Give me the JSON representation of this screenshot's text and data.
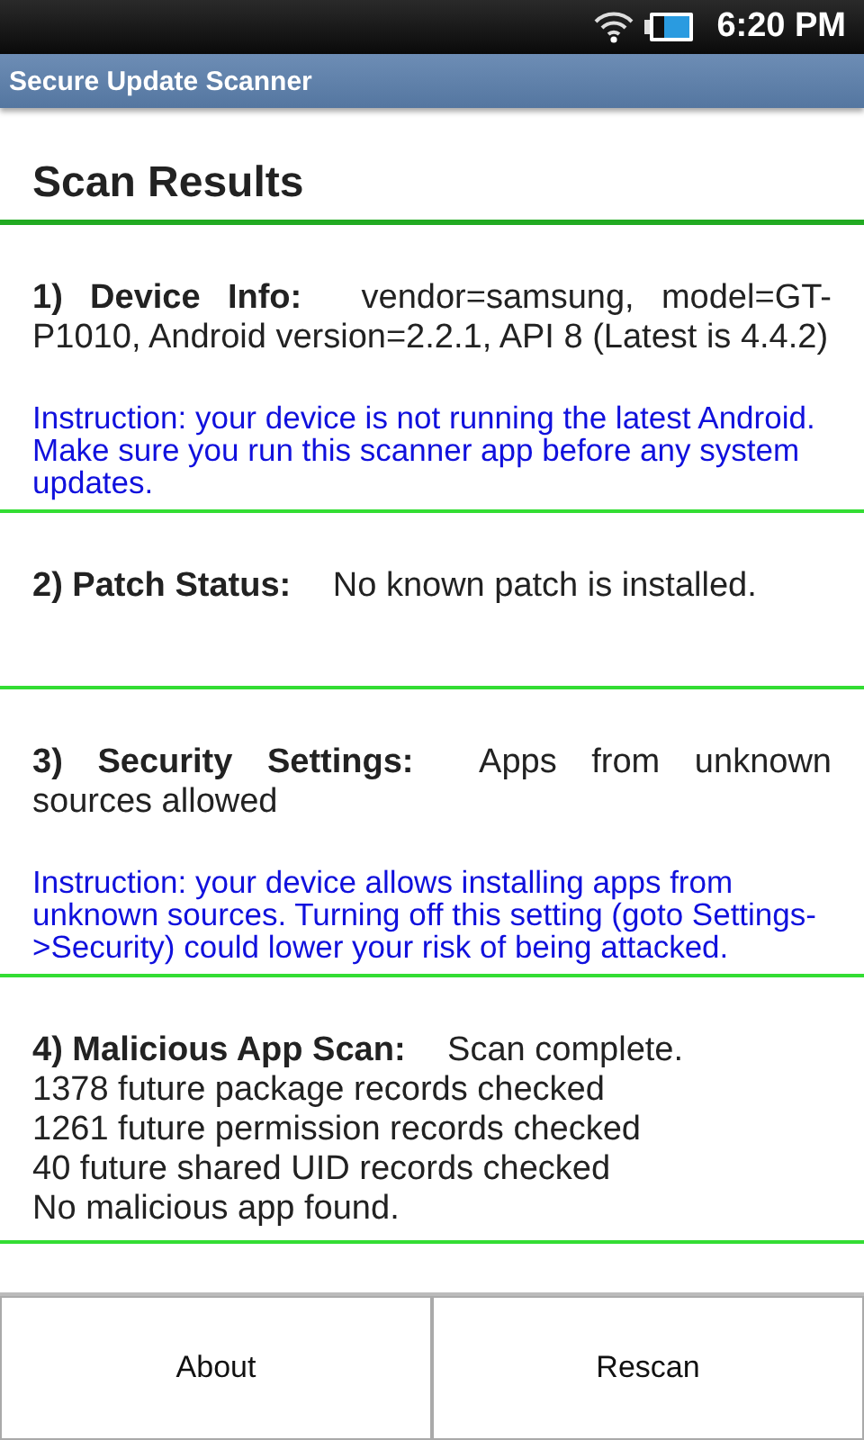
{
  "status_bar": {
    "time": "6:20 PM"
  },
  "window": {
    "title": "Secure Update Scanner"
  },
  "heading": "Scan Results",
  "sections": [
    {
      "label": "1) Device Info:",
      "text": "vendor=samsung, model=GT-P1010, Android version=2.2.1, API 8 (Latest is 4.4.2)",
      "instruction": "Instruction: your device is not running the latest Android. Make sure you run this scanner app before any system updates."
    },
    {
      "label": "2) Patch Status:",
      "text": "No known patch is installed."
    },
    {
      "label": "3) Security Settings:",
      "text": "Apps from unknown sources allowed",
      "instruction": "Instruction: your device allows installing apps from unknown sources. Turning off this setting (goto Settings->Security) could lower your risk of being attacked."
    },
    {
      "label": "4) Malicious App Scan:",
      "text": "Scan complete.",
      "lines": [
        "1378 future package records checked",
        "1261 future permission records checked",
        "40 future shared UID records checked",
        "No malicious app found."
      ]
    }
  ],
  "buttons": [
    "About",
    "Rescan"
  ]
}
